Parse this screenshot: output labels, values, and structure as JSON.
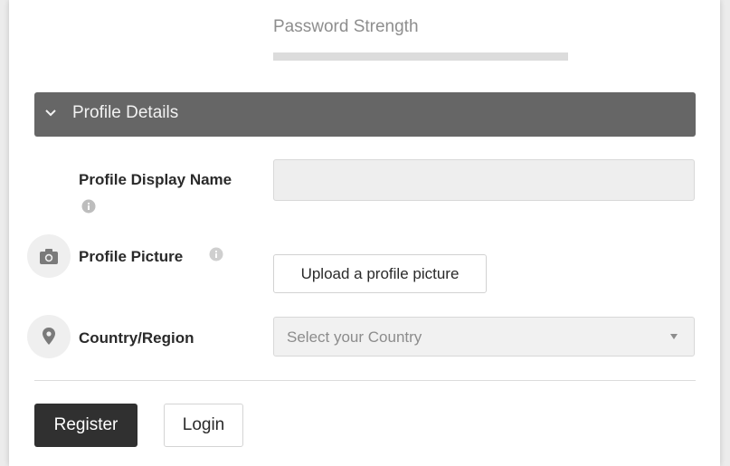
{
  "password": {
    "label": "Password Strength",
    "strength_fraction": 0
  },
  "section": {
    "title": "Profile Details",
    "expanded": true,
    "icon": "chevron-down-icon"
  },
  "fields": {
    "display_name": {
      "label": "Profile Display Name",
      "value": "",
      "placeholder": "",
      "info_icon": "info-icon"
    },
    "picture": {
      "label": "Profile Picture",
      "button_label": "Upload a profile picture",
      "icon": "camera-icon",
      "info_icon": "info-icon"
    },
    "country": {
      "label": "Country/Region",
      "placeholder": "Select your Country",
      "icon": "location-pin-icon"
    }
  },
  "actions": {
    "register_label": "Register",
    "login_label": "Login"
  },
  "colors": {
    "section_header_bg": "#666666",
    "primary_button_bg": "#303030",
    "input_bg": "#eeeeee"
  }
}
